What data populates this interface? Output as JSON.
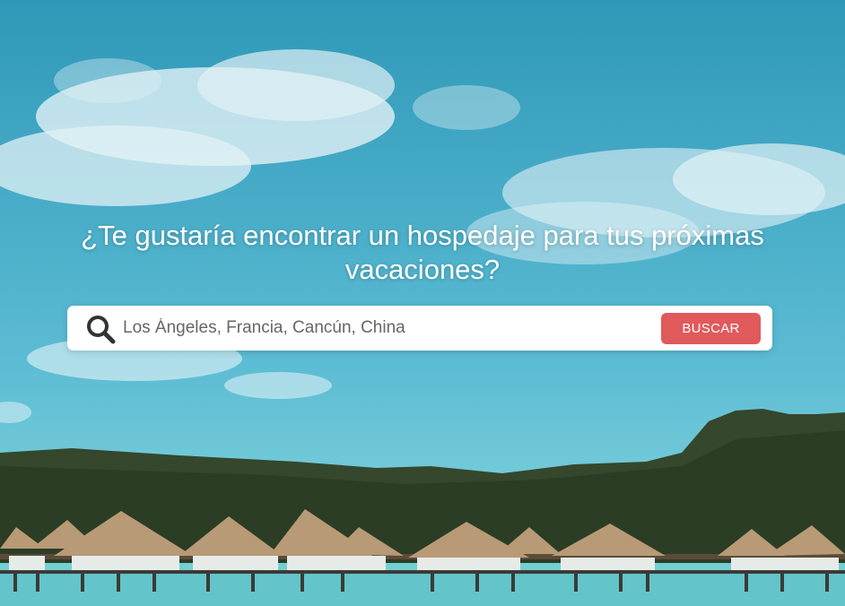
{
  "hero": {
    "headline": "¿Te gustaría encontrar un hospedaje para tus próximas vacaciones?"
  },
  "search": {
    "placeholder": "Los Ángeles, Francia, Cancún, China",
    "value": "",
    "button_label": "BUSCAR",
    "icon": "search-icon"
  },
  "colors": {
    "accent": "#e05a5c",
    "sky": "#45aac6",
    "headline": "#ffffff"
  }
}
